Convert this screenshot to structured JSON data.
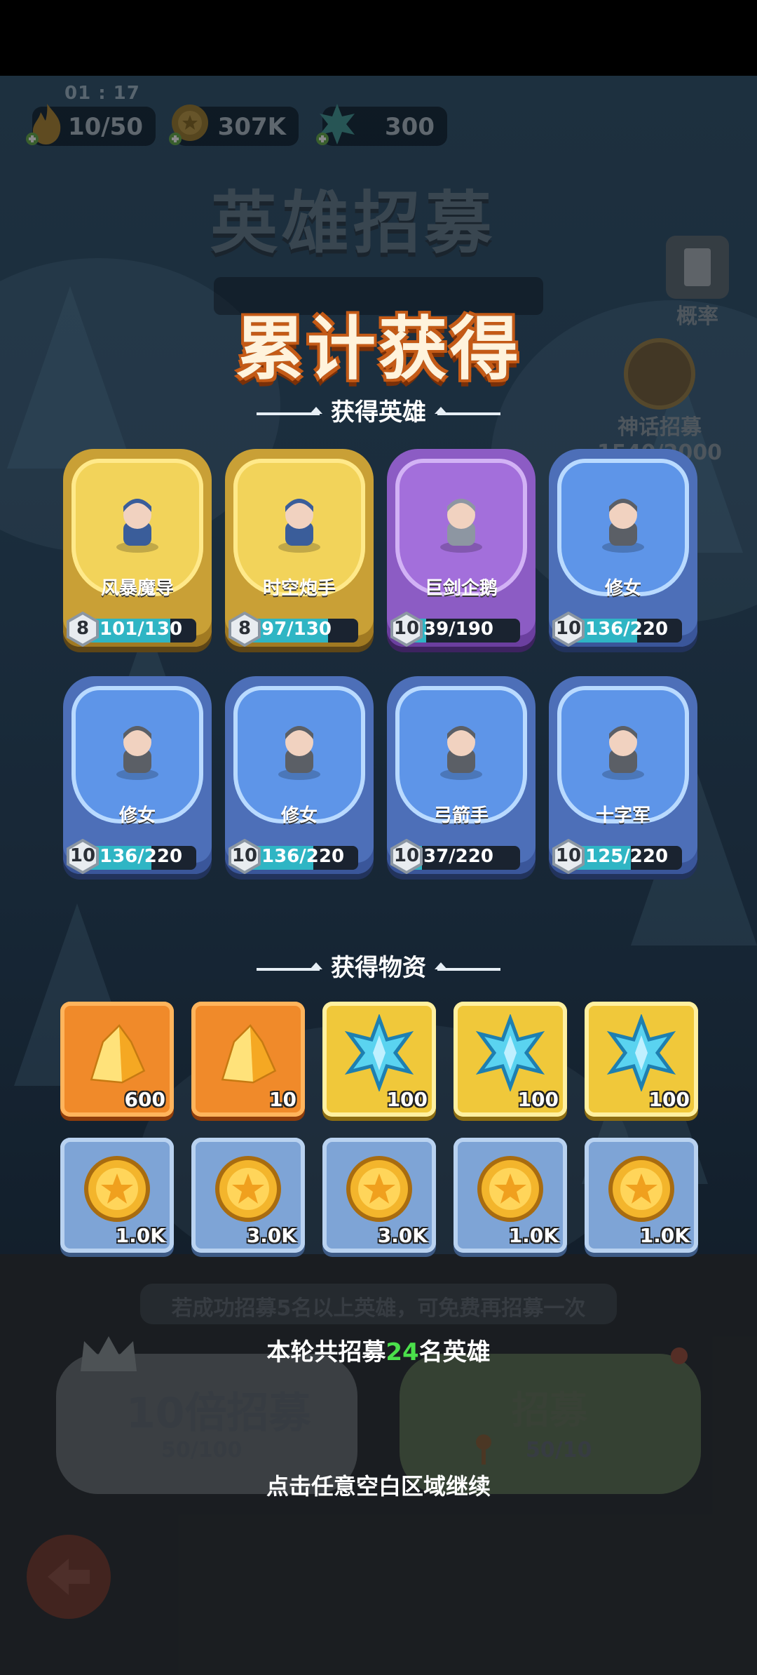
{
  "hud": {
    "timer": "01 : 17",
    "stamina": "10/50",
    "coins": "307K",
    "crystals": "300"
  },
  "background": {
    "title": "英雄招募",
    "rate_label": "概率",
    "myth_label": "神话招募",
    "myth_progress": "1540/2000"
  },
  "overlay": {
    "title": "累计获得",
    "heroes_section": "获得英雄",
    "items_section": "获得物资",
    "recruited_prefix": "本轮共招募",
    "recruited_count": "24",
    "recruited_suffix": "名英雄",
    "continue_hint": "点击任意空白区域继续"
  },
  "heroes": [
    {
      "name": "风暴魔导",
      "level": "8",
      "progress": "101/130",
      "fill": 0.777,
      "rarity": "gold"
    },
    {
      "name": "时空炮手",
      "level": "8",
      "progress": "97/130",
      "fill": 0.746,
      "rarity": "gold"
    },
    {
      "name": "巨剑企鹅",
      "level": "10",
      "progress": "39/190",
      "fill": 0.205,
      "rarity": "purple"
    },
    {
      "name": "修女",
      "level": "10",
      "progress": "136/220",
      "fill": 0.618,
      "rarity": "blue"
    },
    {
      "name": "修女",
      "level": "10",
      "progress": "136/220",
      "fill": 0.618,
      "rarity": "blue"
    },
    {
      "name": "修女",
      "level": "10",
      "progress": "136/220",
      "fill": 0.618,
      "rarity": "blue"
    },
    {
      "name": "弓箭手",
      "level": "10",
      "progress": "37/220",
      "fill": 0.168,
      "rarity": "blue"
    },
    {
      "name": "十字军",
      "level": "10",
      "progress": "125/220",
      "fill": 0.568,
      "rarity": "blue"
    }
  ],
  "items": [
    {
      "icon": "gold-crystal-icon",
      "qty": "600",
      "style": "orange"
    },
    {
      "icon": "gold-crystal-icon",
      "qty": "10",
      "style": "orange"
    },
    {
      "icon": "blue-snowflake-gem-icon",
      "qty": "100",
      "style": "yellow"
    },
    {
      "icon": "blue-snowflake-gem-icon",
      "qty": "100",
      "style": "yellow"
    },
    {
      "icon": "blue-snowflake-gem-icon",
      "qty": "100",
      "style": "yellow"
    },
    {
      "icon": "gold-coin-icon",
      "qty": "1.0K",
      "style": "lblue"
    },
    {
      "icon": "gold-coin-icon",
      "qty": "3.0K",
      "style": "lblue"
    },
    {
      "icon": "gold-coin-icon",
      "qty": "3.0K",
      "style": "lblue"
    },
    {
      "icon": "gold-coin-icon",
      "qty": "1.0K",
      "style": "lblue"
    },
    {
      "icon": "gold-coin-icon",
      "qty": "1.0K",
      "style": "lblue"
    }
  ],
  "bottom": {
    "tip": "若成功招募5名以上英雄，可免费再招募一次",
    "ten_pull_label": "10倍招募",
    "ten_pull_cost": "50/100",
    "single_pull_label": "招募",
    "single_pull_cost": "50/10"
  },
  "colors": {
    "accent_green": "#4be04b",
    "title_orange": "#c45a16",
    "progress_teal": "#2fb5c4"
  }
}
